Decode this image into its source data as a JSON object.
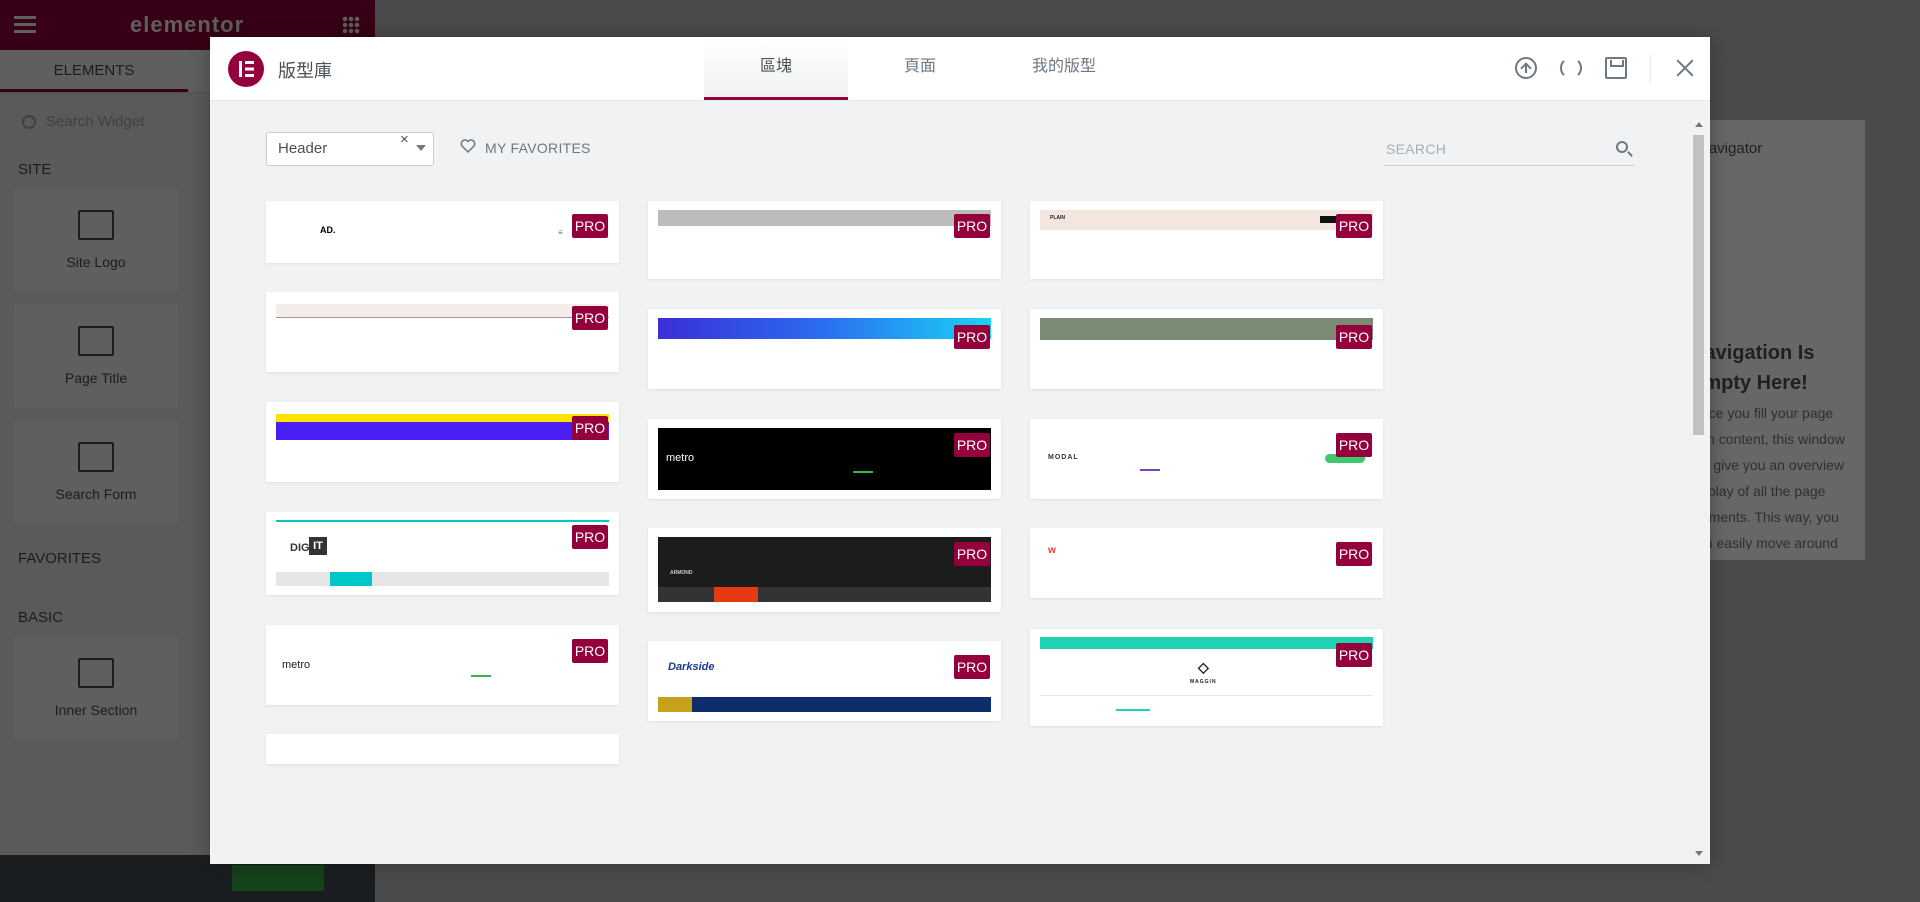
{
  "editor": {
    "brand": "elementor",
    "tab_elements": "ELEMENTS",
    "search_placeholder": "Search Widget",
    "category_site": "SITE",
    "category_favorites": "FAVORITES",
    "category_basic": "BASIC",
    "widgets": [
      "Site Logo",
      "Page Title",
      "Search Form",
      "Inner Section"
    ]
  },
  "navigator": {
    "title": "Navigator",
    "empty_title": "Navigation Is Empty Here!",
    "empty_text": "Once you fill your page with content, this window will give you an overview display of all the page elements. This way, you can easily move around any section, column, or widget."
  },
  "library": {
    "title": "版型庫",
    "tabs": [
      "區塊",
      "頁面",
      "我的版型"
    ],
    "active_tab": 0,
    "filter_value": "Header",
    "favorites_label": "MY FAVORITES",
    "search_placeholder": "SEARCH",
    "pro_label": "PRO",
    "thumb_texts": {
      "ad": "AD.",
      "metro": "metro",
      "dig": "DIG",
      "it": "IT",
      "modal": "MODAL",
      "armond": "ARMOND",
      "darkside": "Darkside",
      "maggin": "MAGGIN",
      "plain": "PLAIN"
    }
  },
  "colors": {
    "accent": "#93003c",
    "green": "#39b54a",
    "teal": "#00c8c8"
  }
}
